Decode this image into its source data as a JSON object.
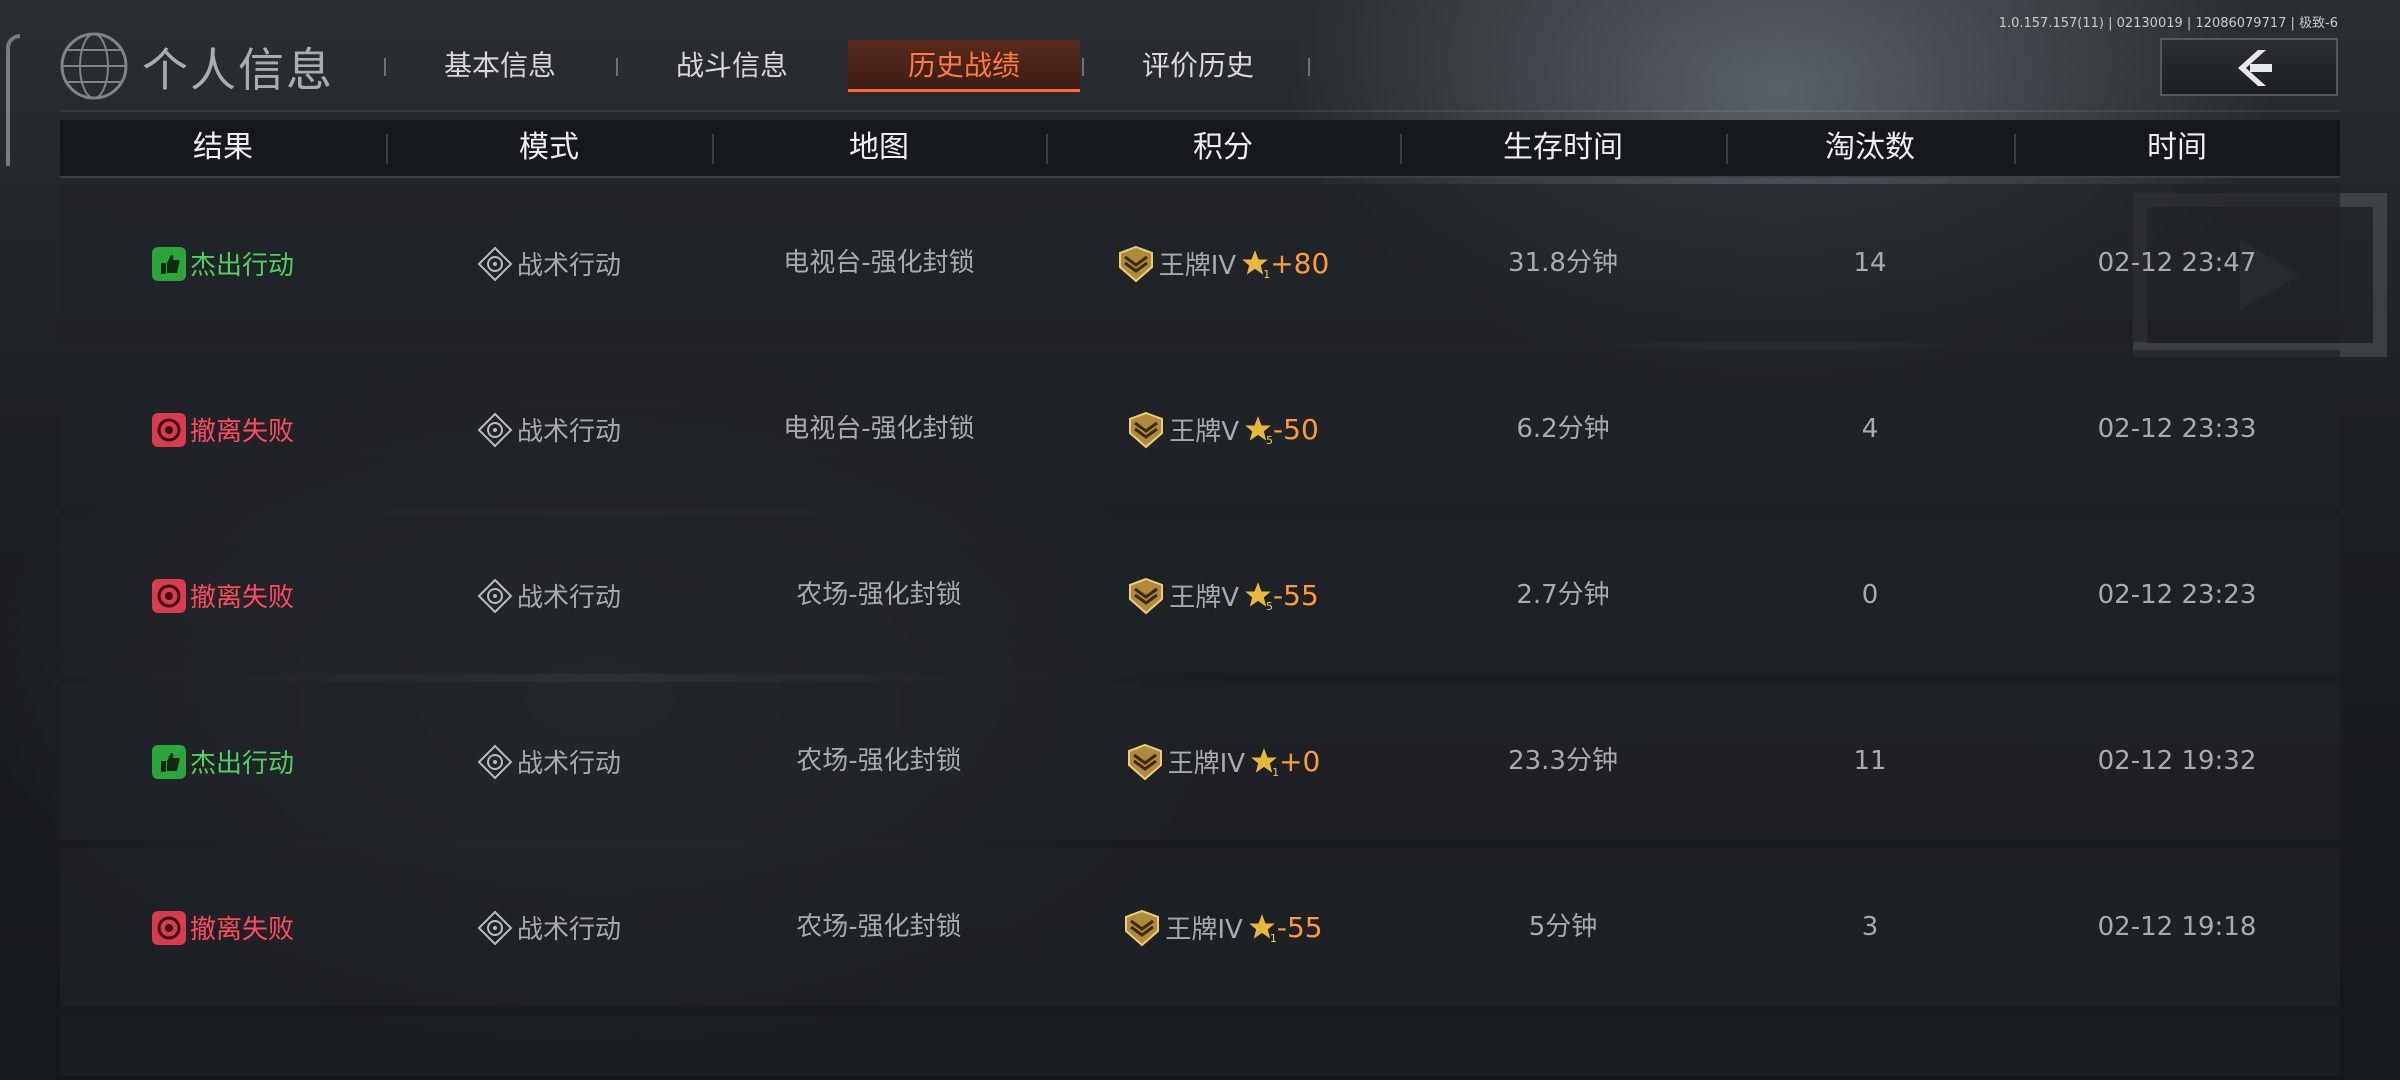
{
  "header": {
    "title": "个人信息",
    "tabs": [
      {
        "label": "基本信息",
        "active": false
      },
      {
        "label": "战斗信息",
        "active": false
      },
      {
        "label": "历史战绩",
        "active": true
      },
      {
        "label": "评价历史",
        "active": false
      }
    ],
    "version_text": "1.0.157.157(11) | 02130019 | 12086079717 | 极致-6",
    "back_icon": "chevron-left-icon"
  },
  "table": {
    "columns": [
      "结果",
      "模式",
      "地图",
      "积分",
      "生存时间",
      "淘汰数",
      "时间"
    ],
    "rows": [
      {
        "result": "杰出行动",
        "result_type": "success",
        "mode": "战术行动",
        "map": "电视台-强化封锁",
        "rank": "王牌IV",
        "star_level": "1",
        "delta": "+80",
        "survival": "31.8分钟",
        "kills": "14",
        "time": "02-12 23:47"
      },
      {
        "result": "撤离失败",
        "result_type": "fail",
        "mode": "战术行动",
        "map": "电视台-强化封锁",
        "rank": "王牌V",
        "star_level": "5",
        "delta": "-50",
        "survival": "6.2分钟",
        "kills": "4",
        "time": "02-12 23:33"
      },
      {
        "result": "撤离失败",
        "result_type": "fail",
        "mode": "战术行动",
        "map": "农场-强化封锁",
        "rank": "王牌V",
        "star_level": "5",
        "delta": "-55",
        "survival": "2.7分钟",
        "kills": "0",
        "time": "02-12 23:23"
      },
      {
        "result": "杰出行动",
        "result_type": "success",
        "mode": "战术行动",
        "map": "农场-强化封锁",
        "rank": "王牌IV",
        "star_level": "1",
        "delta": "+0",
        "survival": "23.3分钟",
        "kills": "11",
        "time": "02-12 19:32"
      },
      {
        "result": "撤离失败",
        "result_type": "fail",
        "mode": "战术行动",
        "map": "农场-强化封锁",
        "rank": "王牌IV",
        "star_level": "1",
        "delta": "-55",
        "survival": "5分钟",
        "kills": "3",
        "time": "02-12 19:18"
      }
    ]
  },
  "colors": {
    "accent": "#ff6a24",
    "success": "#4ed25f",
    "fail": "#ff4b62",
    "score_delta": "#ff9a3a"
  }
}
